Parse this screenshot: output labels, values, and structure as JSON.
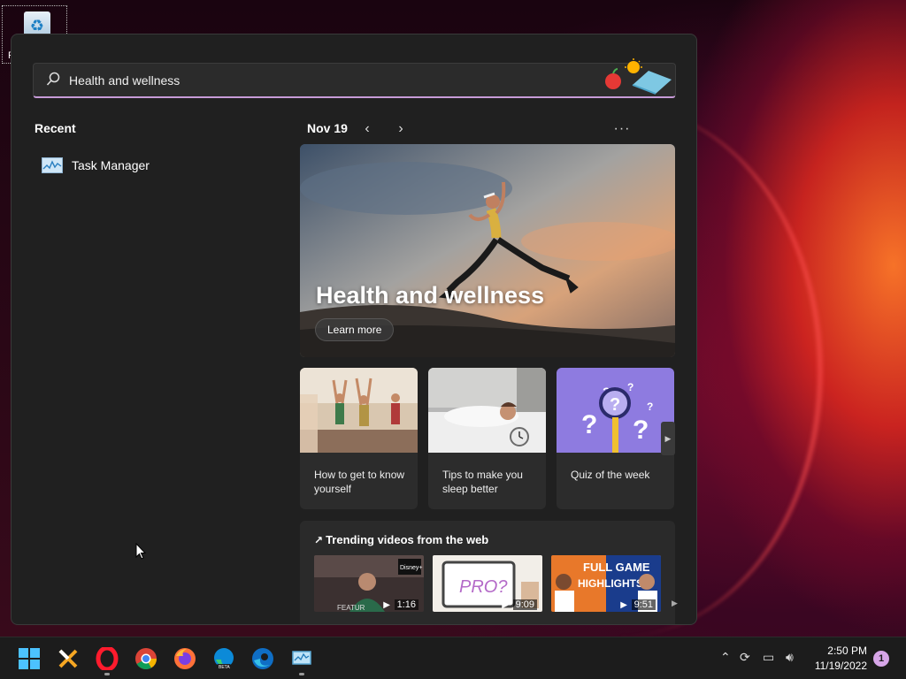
{
  "desktop": {
    "recycle_bin_label": "R"
  },
  "search": {
    "value": "Health and wellness",
    "decor_icon": "apple-sun-yoga-mat-icon"
  },
  "recent": {
    "title": "Recent",
    "items": [
      {
        "label": "Task Manager",
        "icon": "task-manager-icon"
      }
    ]
  },
  "feed": {
    "date": "Nov 19",
    "prev_icon": "chevron-left-icon",
    "next_icon": "chevron-right-icon",
    "more_icon": "more-icon",
    "hero": {
      "title": "Health and wellness",
      "button": "Learn more"
    },
    "cards": [
      {
        "label": "How to get to know yourself"
      },
      {
        "label": "Tips to make you sleep better"
      },
      {
        "label": "Quiz of the week"
      }
    ],
    "trending": {
      "title": "Trending videos from the web",
      "videos": [
        {
          "duration": "1:16",
          "overlay": "FEATUR"
        },
        {
          "duration": "9:09",
          "overlay": "PRO?"
        },
        {
          "duration": "9:51",
          "overlay": "FULL GAME HIGHLIGHTS"
        }
      ]
    }
  },
  "taskbar": {
    "apps": [
      "windows-start-icon",
      "x-app-icon",
      "opera-icon",
      "chrome-icon",
      "firefox-icon",
      "edge-beta-icon",
      "edge-icon",
      "task-manager-icon"
    ],
    "clock_time": "2:50 PM",
    "clock_date": "11/19/2022",
    "notification_count": "1"
  },
  "colors": {
    "panel_bg": "#202020",
    "card_bg": "#2c2c2c",
    "accent_underline": "#c79bd8",
    "notification_badge": "#d7a6e8"
  }
}
